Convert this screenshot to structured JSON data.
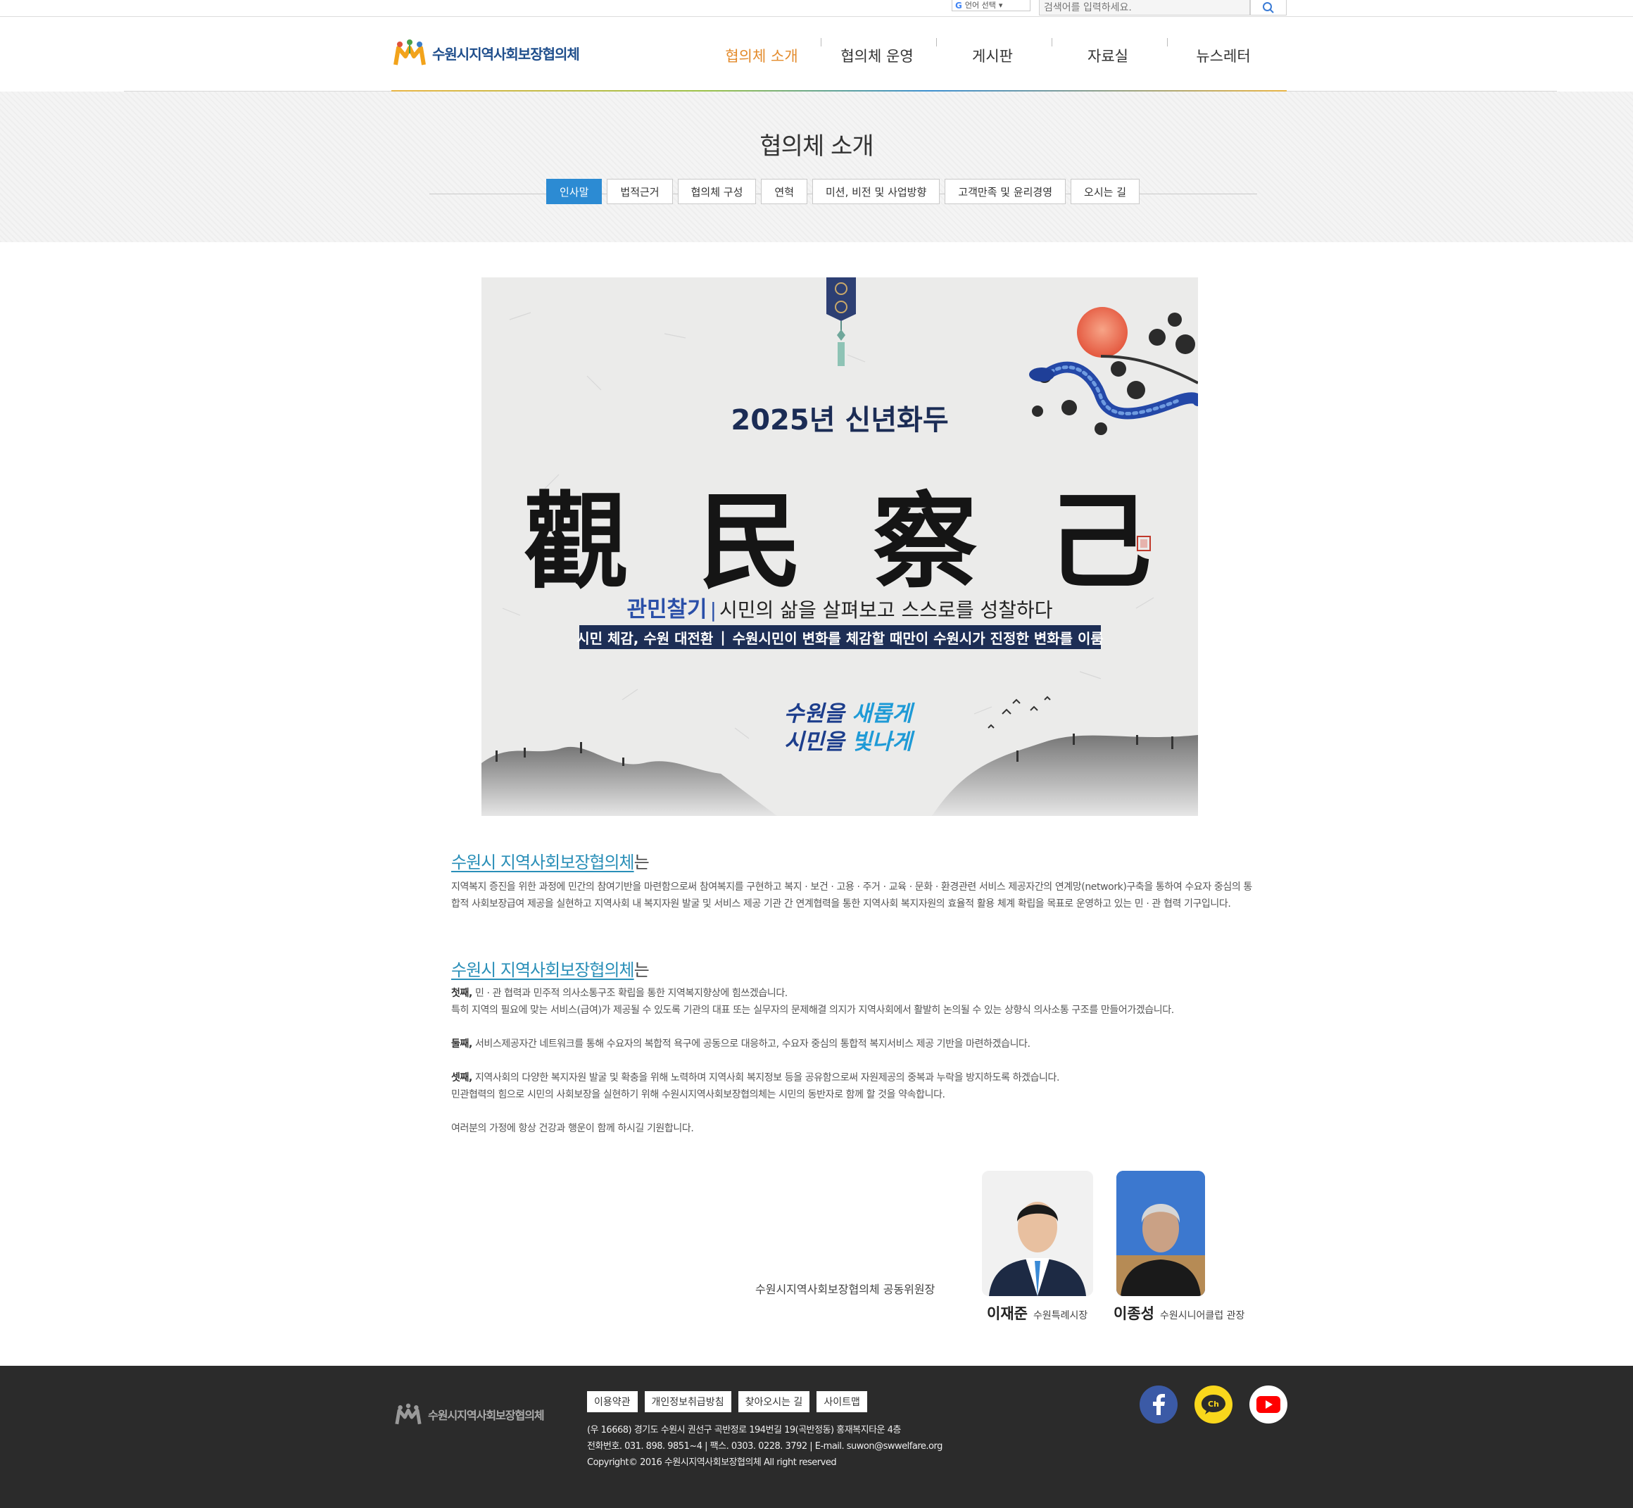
{
  "top": {
    "translate_label": "언어 선택",
    "search_placeholder": "검색어를 입력하세요."
  },
  "header": {
    "logo_text": "수원시지역사회보장협의체",
    "nav": [
      "협의체 소개",
      "협의체 운영",
      "게시판",
      "자료실",
      "뉴스레터"
    ],
    "active_nav": "협의체 소개"
  },
  "subvisual": {
    "title": "협의체 소개",
    "tabs": [
      "인사말",
      "법적근거",
      "협의체 구성",
      "연혁",
      "미션, 비전 및 사업방향",
      "고객만족 및 윤리경영",
      "오시는 길"
    ],
    "active_tab": "인사말"
  },
  "banner": {
    "year_title": "2025년 신년화두",
    "hanja": [
      "觀",
      "民",
      "察",
      "己"
    ],
    "keyword": "관민찰기",
    "meaning": "시민의 삶을 살펴보고 스스로를 성찰하다",
    "strip_left": "시민 체감, 수원 대전환",
    "strip_right": "수원시민이 변화를 체감할 때만이 수원시가 진정한 변화를 이룸",
    "slogan_line1_a": "수원을 ",
    "slogan_line1_b": "새롭게",
    "slogan_line2_a": "시민을 ",
    "slogan_line2_b": "빛나게"
  },
  "intro": {
    "org": "수원시 지역사회보장협의체",
    "suffix": "는",
    "paragraph": "지역복지 증진을 위한 과정에 민간의 참여기반을 마련함으로써 참여복지를 구현하고 복지 · 보건 · 고용 · 주거 · 교육 · 문화 · 환경관련 서비스 제공자간의 연계망(network)구축을 통하여 수요자 중심의 통합적 사회보장급여 제공을 실현하고 지역사회 내 복지자원 발굴 및 서비스 제공 기관 간 연계협력을 통한 지역사회 복지자원의 효율적 활용 체계 확립을 목표로 운영하고 있는 민 · 관 협력 기구입니다."
  },
  "section2": {
    "org": "수원시 지역사회보장협의체",
    "suffix": "는",
    "first_label": "첫째,",
    "first_text": " 민 · 관 협력과 민주적 의사소통구조 확립을 통한 지역복지향상에 힘쓰겠습니다.",
    "first_text2": "특히 지역의 필요에 맞는 서비스(급여)가 제공될 수 있도록 기관의 대표 또는 실무자의 문제해결 의지가 지역사회에서 활발히 논의될 수 있는 상향식 의사소통 구조를 만들어가겠습니다.",
    "second_label": "둘째,",
    "second_text": " 서비스제공자간 네트워크를 통해 수요자의 복합적 욕구에 공동으로 대응하고, 수요자 중심의 통합적 복지서비스 제공 기반을 마련하겠습니다.",
    "third_label": "셋째,",
    "third_text": " 지역사회의 다양한 복지자원 발굴 및 확충을 위해 노력하며 지역사회 복지정보 등을 공유함으로써 자원제공의 중복과 누락을 방지하도록 하겠습니다.",
    "third_text2": "민관협력의 힘으로 시민의 사회보장을 실현하기 위해 수원시지역사회보장협의체는 시민의 동반자로 함께 할 것을 약속합니다.",
    "closing": "여러분의 가정에 항상 건강과 행운이 함께 하시길 기원합니다."
  },
  "signature": {
    "label": "수원시지역사회보장협의체 공동위원장",
    "person1_name": "이재준",
    "person1_role": "수원특례시장",
    "person2_name": "이종성",
    "person2_role": "수원시니어클럽 관장"
  },
  "footer": {
    "logo_text": "수원시지역사회보장협의체",
    "links": [
      "이용약관",
      "개인정보취급방침",
      "찾아오시는 길",
      "사이트맵"
    ],
    "address": "(우 16668) 경기도 수원시 권선구 곡반정로 194번길 19(곡반정동) 홍재복지타운 4층",
    "contact": "전화번호. 031. 898. 9851~4  |  팩스. 0303. 0228. 3792  |  E-mail. suwon@swwelfare.org",
    "copyright": "Copyright© 2016 수원시지역사회보장협의체 All right reserved",
    "sns": [
      "facebook-icon",
      "kakao-channel-icon",
      "youtube-icon"
    ]
  },
  "colors": {
    "accent_orange": "#e38b2c",
    "tab_blue": "#2c8bd3",
    "link_teal": "#2a8fb8",
    "footer_bg": "#2b2b2b"
  }
}
